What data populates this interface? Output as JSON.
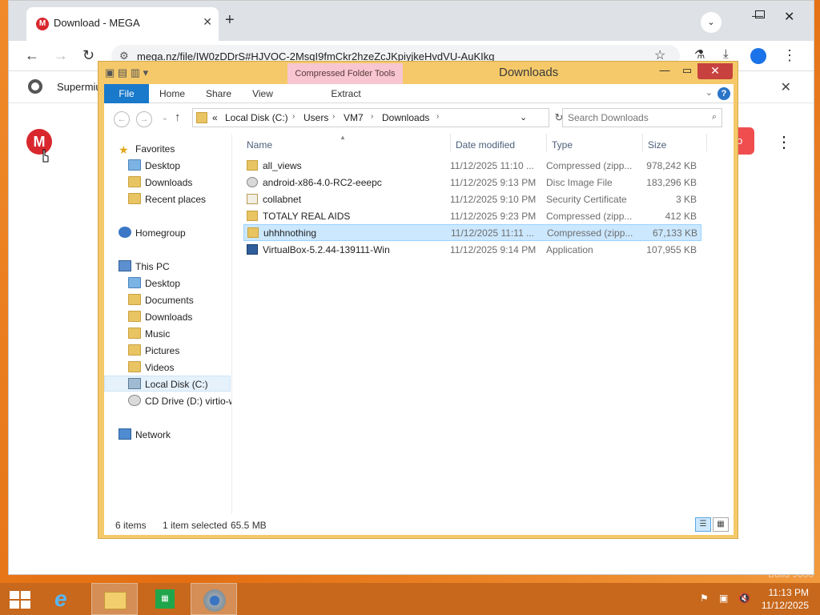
{
  "chrome": {
    "tab_title": "Download - MEGA",
    "tab_favicon": "M",
    "new_tab": "+",
    "url": "mega.nz/file/IW0zDDrS#HJVOC-2MsqI9fmCkr2hzeZcJKpiyjkeHvdVU-AuKIkg",
    "bookmark_text": "Supermiu",
    "mega_logo": "M",
    "mega_button_fragment": "o"
  },
  "explorer": {
    "window_title": "Downloads",
    "context_tab": "Compressed Folder Tools",
    "ribbon_tabs": [
      "File",
      "Home",
      "Share",
      "View",
      "Extract"
    ],
    "address": {
      "overflow": "«",
      "crumbs": [
        "Local Disk (C:)",
        "Users",
        "VM7",
        "Downloads"
      ]
    },
    "search_placeholder": "Search Downloads",
    "nav": {
      "favorites": "Favorites",
      "favorites_items": [
        "Desktop",
        "Downloads",
        "Recent places"
      ],
      "homegroup": "Homegroup",
      "this_pc": "This PC",
      "pc_items": [
        "Desktop",
        "Documents",
        "Downloads",
        "Music",
        "Pictures",
        "Videos",
        "Local Disk (C:)",
        "CD Drive (D:) virtio-w"
      ],
      "network": "Network"
    },
    "columns": [
      "Name",
      "Date modified",
      "Type",
      "Size"
    ],
    "files": [
      {
        "name": "all_views",
        "date": "11/12/2025 11:10 ...",
        "type": "Compressed (zipp...",
        "size": "978,242 KB",
        "icon": "zip-folder-icon"
      },
      {
        "name": "android-x86-4.0-RC2-eeepc",
        "date": "11/12/2025 9:13 PM",
        "type": "Disc Image File",
        "size": "183,296 KB",
        "icon": "disc-image-icon"
      },
      {
        "name": "collabnet",
        "date": "11/12/2025 9:10 PM",
        "type": "Security Certificate",
        "size": "3 KB",
        "icon": "certificate-icon"
      },
      {
        "name": "TOTALY REAL AIDS",
        "date": "11/12/2025 9:23 PM",
        "type": "Compressed (zipp...",
        "size": "412 KB",
        "icon": "zip-folder-icon"
      },
      {
        "name": "uhhhnothing",
        "date": "11/12/2025 11:11 ...",
        "type": "Compressed (zipp...",
        "size": "67,133 KB",
        "icon": "zip-folder-icon",
        "selected": true
      },
      {
        "name": "VirtualBox-5.2.44-139111-Win",
        "date": "11/12/2025 9:14 PM",
        "type": "Application",
        "size": "107,955 KB",
        "icon": "application-icon"
      }
    ],
    "status": {
      "count": "6 items",
      "selected": "1 item selected",
      "size": "65.5 MB"
    }
  },
  "taskbar": {
    "time": "11:13 PM",
    "date": "11/12/2025"
  },
  "desktop": {
    "watermark": "Build 9600"
  }
}
